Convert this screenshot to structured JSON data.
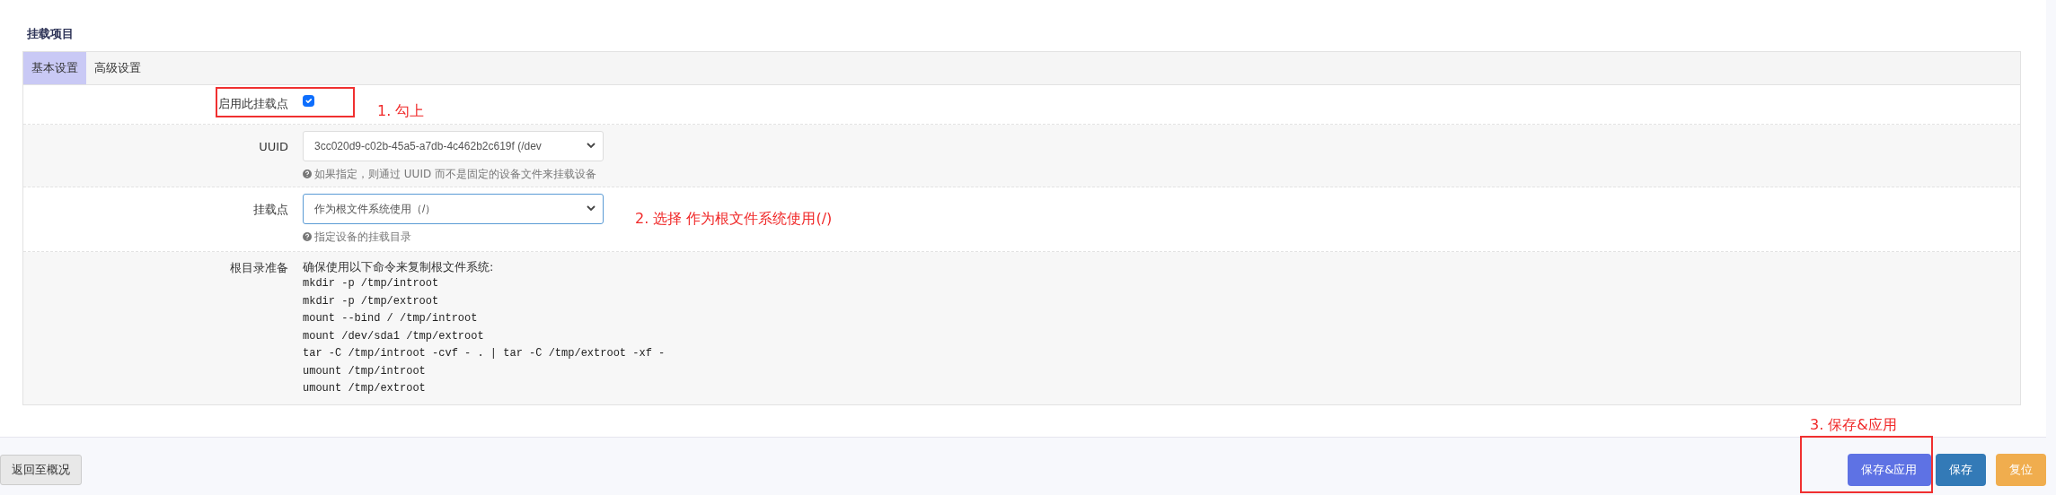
{
  "section_title": "挂载项目",
  "tabs": [
    {
      "label": "基本设置",
      "selected": true
    },
    {
      "label": "高级设置",
      "selected": false
    }
  ],
  "fields": [
    {
      "kind": "checkbox",
      "label": "启用此挂载点",
      "checked": true,
      "highlighted": true
    },
    {
      "kind": "select",
      "label": "UUID",
      "value": "3cc020d9-c02b-45a5-a7db-4c462b2c619f (/dev",
      "hint": "如果指定，则通过 UUID 而不是固定的设备文件来挂载设备",
      "focused": false
    },
    {
      "kind": "select",
      "label": "挂载点",
      "value": "作为根文件系统使用（/）",
      "hint": "指定设备的挂载目录",
      "focused": true
    },
    {
      "kind": "commands",
      "label": "根目录准备",
      "intro": "确保使用以下命令来复制根文件系统:",
      "lines": [
        "mkdir -p /tmp/introot",
        "mkdir -p /tmp/extroot",
        "mount --bind / /tmp/introot",
        "mount /dev/sda1 /tmp/extroot",
        "tar -C /tmp/introot -cvf - . | tar -C /tmp/extroot -xf -",
        "umount /tmp/introot",
        "umount /tmp/extroot"
      ]
    }
  ],
  "footer": {
    "back_button": "返回至概况",
    "actions": [
      {
        "label": "保存&应用",
        "kind": "apply",
        "highlighted": true
      },
      {
        "label": "保存",
        "kind": "save",
        "highlighted": false
      },
      {
        "label": "复位",
        "kind": "reset",
        "highlighted": false
      }
    ]
  },
  "annotations": [
    {
      "text": "1. 勾上"
    },
    {
      "text": "2. 选择 作为根文件系统使用(/)"
    },
    {
      "text": "3. 保存&应用"
    }
  ]
}
